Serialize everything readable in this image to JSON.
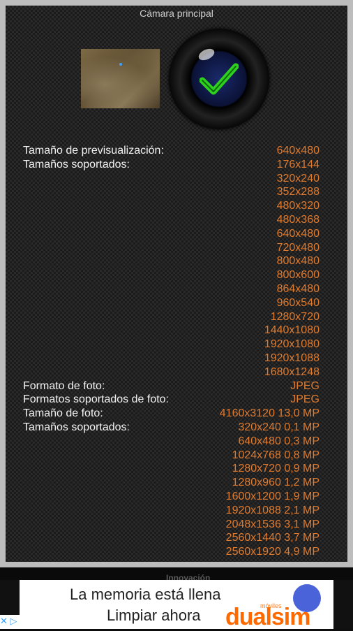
{
  "title": "Cámara principal",
  "rows": [
    {
      "label": "Tamaño de previsualización:",
      "value": "640x480"
    },
    {
      "label": "Tamaños soportados:",
      "value": "176x144"
    },
    {
      "label": "",
      "value": "320x240"
    },
    {
      "label": "",
      "value": "352x288"
    },
    {
      "label": "",
      "value": "480x320"
    },
    {
      "label": "",
      "value": "480x368"
    },
    {
      "label": "",
      "value": "640x480"
    },
    {
      "label": "",
      "value": "720x480"
    },
    {
      "label": "",
      "value": "800x480"
    },
    {
      "label": "",
      "value": "800x600"
    },
    {
      "label": "",
      "value": "864x480"
    },
    {
      "label": "",
      "value": "960x540"
    },
    {
      "label": "",
      "value": "1280x720"
    },
    {
      "label": "",
      "value": "1440x1080"
    },
    {
      "label": "",
      "value": "1920x1080"
    },
    {
      "label": "",
      "value": "1920x1088"
    },
    {
      "label": "",
      "value": "1680x1248"
    },
    {
      "label": "Formato de foto:",
      "value": "JPEG"
    },
    {
      "label": "Formatos soportados de foto:",
      "value": "JPEG"
    },
    {
      "label": "Tamaño de foto:",
      "value": "4160x3120 13,0 MP"
    },
    {
      "label": "Tamaños soportados:",
      "value": "320x240 0,1 MP"
    },
    {
      "label": "",
      "value": "640x480 0,3 MP"
    },
    {
      "label": "",
      "value": "1024x768 0,8 MP"
    },
    {
      "label": "",
      "value": "1280x720 0,9 MP"
    },
    {
      "label": "",
      "value": "1280x960 1,2 MP"
    },
    {
      "label": "",
      "value": "1600x1200 1,9 MP"
    },
    {
      "label": "",
      "value": "1920x1088 2,1 MP"
    },
    {
      "label": "",
      "value": "2048x1536 3,1 MP"
    },
    {
      "label": "",
      "value": "2560x1440 3,7 MP"
    },
    {
      "label": "",
      "value": "2560x1920 4,9 MP"
    }
  ],
  "ad": {
    "top_text": "Innovación",
    "line1": "La memoria está llena",
    "line2": "Limpiar ahora",
    "brand_small": "móviles",
    "brand": "dualsim",
    "corner": "✕ ▷"
  }
}
